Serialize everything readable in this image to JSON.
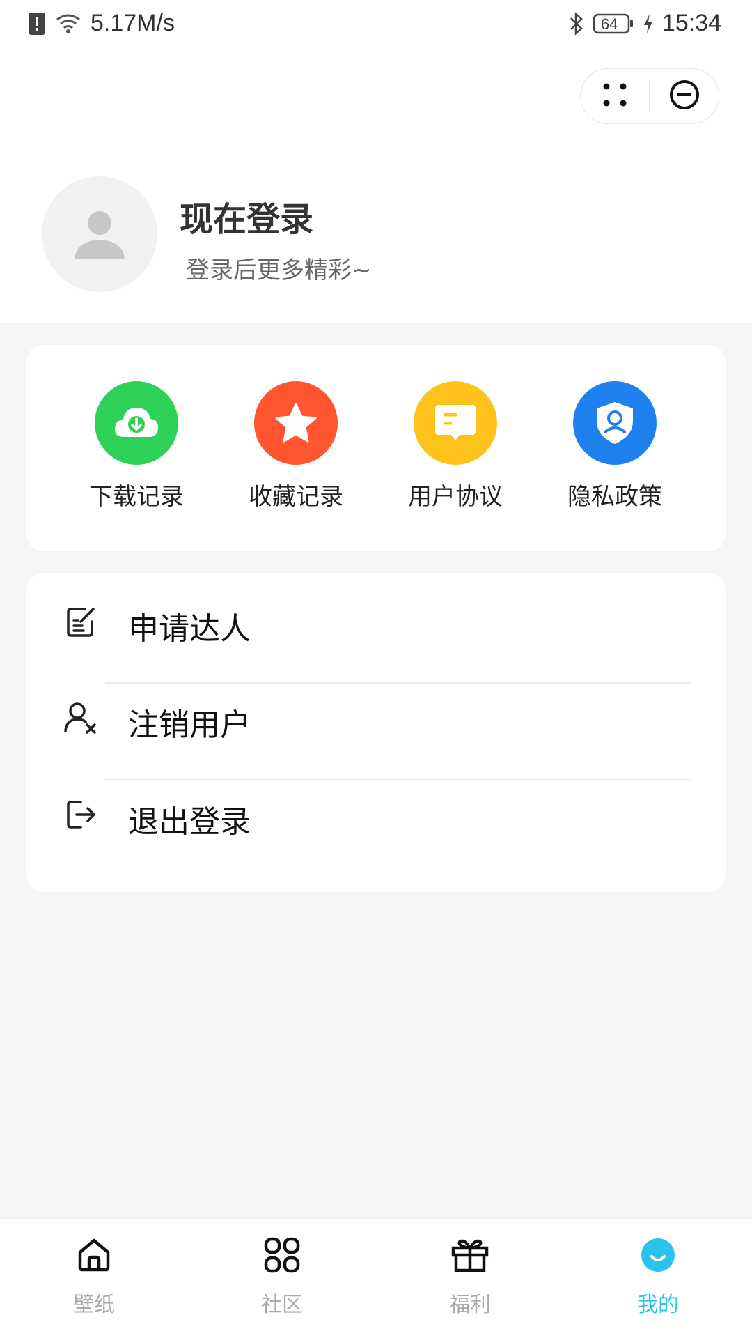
{
  "status_bar": {
    "speed": "5.17M/s",
    "battery": "64",
    "time": "15:34"
  },
  "capsule": {
    "menu_icon": "more-dots-icon",
    "close_icon": "minus-circle-icon"
  },
  "profile": {
    "title": "现在登录",
    "subtitle": "登录后更多精彩~"
  },
  "quick_actions": [
    {
      "label": "下载记录",
      "icon": "cloud-download-icon",
      "color": "#2ed158"
    },
    {
      "label": "收藏记录",
      "icon": "star-icon",
      "color": "#ff5530"
    },
    {
      "label": "用户协议",
      "icon": "message-icon",
      "color": "#ffc21a"
    },
    {
      "label": "隐私政策",
      "icon": "shield-user-icon",
      "color": "#1f80f0"
    }
  ],
  "menu": [
    {
      "label": "申请达人",
      "icon": "edit-note-icon"
    },
    {
      "label": "注销用户",
      "icon": "user-remove-icon"
    },
    {
      "label": "退出登录",
      "icon": "logout-icon"
    }
  ],
  "tabs": [
    {
      "label": "壁纸",
      "icon": "home-icon"
    },
    {
      "label": "社区",
      "icon": "grid-icon"
    },
    {
      "label": "福利",
      "icon": "gift-icon"
    },
    {
      "label": "我的",
      "icon": "smile-icon",
      "active": true
    }
  ],
  "colors": {
    "accent": "#29c4ee",
    "background": "#f5f5f5"
  }
}
